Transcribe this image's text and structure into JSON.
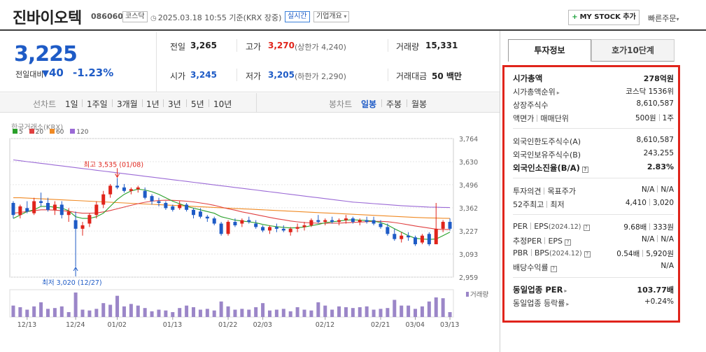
{
  "header": {
    "title": "진바이오텍",
    "code": "086060",
    "market_tag": "코스닥",
    "datetime": "2025.03.18 10:55 기준(KRX 장중)",
    "realtime_tag": "실시간",
    "company_tag": "기업개요",
    "mystock_plus": "+",
    "mystock_label": "MY STOCK 추가",
    "quick_order": "빠른주문"
  },
  "summary": {
    "price": "3,225",
    "change_label": "전일대비",
    "change_arrow": "▼",
    "change_value": "40",
    "change_pct": "-1.23%",
    "prev_close_label": "전일",
    "prev_close": "3,265",
    "high_label": "고가",
    "high": "3,270",
    "upper_limit": "(상한가 4,240)",
    "volume_label": "거래량",
    "volume": "15,331",
    "open_label": "시가",
    "open": "3,245",
    "low_label": "저가",
    "low": "3,205",
    "lower_limit": "(하한가 2,290)",
    "amount_label": "거래대금",
    "amount": "50 백만"
  },
  "period_bar": {
    "line_chart": "선차트",
    "periods": [
      "1일",
      "1주일",
      "3개월",
      "1년",
      "3년",
      "5년",
      "10년"
    ],
    "candle_chart": "봉차트",
    "candle_periods": [
      "일봉",
      "주봉",
      "월봉"
    ],
    "selected_candle": "일봉"
  },
  "chart_data": {
    "type": "candlestick",
    "source": "한국거래소(KRX)",
    "ma_legend": [
      {
        "name": "5",
        "color": "#2aa02a"
      },
      {
        "name": "20",
        "color": "#e04040"
      },
      {
        "name": "60",
        "color": "#f08a24"
      },
      {
        "name": "120",
        "color": "#9b6ad6"
      }
    ],
    "y_ticks": [
      3764,
      3630,
      3496,
      3362,
      3227,
      3093,
      2959
    ],
    "y_tick_labels": [
      "3,764",
      "3,630",
      "3,496",
      "3,362",
      "3,227",
      "3,093",
      "2,959"
    ],
    "x_labels": [
      "12/13",
      "12/24",
      "01/02",
      "01/13",
      "01/22",
      "02/03",
      "02/12",
      "02/21",
      "03/04",
      "03/13"
    ],
    "max_annotation": "최고 3,535 (01/08)",
    "min_annotation": "최저 3,020 (12/27)",
    "volume_label": "거래량",
    "candles": [
      [
        3390,
        3400,
        3300,
        3320
      ],
      [
        3320,
        3380,
        3300,
        3370
      ],
      [
        3360,
        3400,
        3330,
        3340
      ],
      [
        3330,
        3420,
        3320,
        3400
      ],
      [
        3400,
        3450,
        3370,
        3390
      ],
      [
        3390,
        3420,
        3340,
        3350
      ],
      [
        3350,
        3400,
        3320,
        3380
      ],
      [
        3380,
        3400,
        3300,
        3320
      ],
      [
        3320,
        3360,
        3280,
        3340
      ],
      [
        3290,
        3340,
        3020,
        3240
      ],
      [
        3240,
        3280,
        3200,
        3260
      ],
      [
        3270,
        3330,
        3250,
        3320
      ],
      [
        3320,
        3400,
        3300,
        3380
      ],
      [
        3380,
        3460,
        3360,
        3440
      ],
      [
        3440,
        3500,
        3420,
        3490
      ],
      [
        3490,
        3535,
        3470,
        3480
      ],
      [
        3480,
        3500,
        3450,
        3460
      ],
      [
        3460,
        3480,
        3440,
        3470
      ],
      [
        3470,
        3490,
        3450,
        3480
      ],
      [
        3460,
        3480,
        3410,
        3420
      ],
      [
        3430,
        3440,
        3380,
        3400
      ],
      [
        3400,
        3420,
        3370,
        3390
      ],
      [
        3390,
        3400,
        3350,
        3360
      ],
      [
        3370,
        3380,
        3340,
        3350
      ],
      [
        3360,
        3400,
        3350,
        3380
      ],
      [
        3380,
        3390,
        3340,
        3350
      ],
      [
        3350,
        3360,
        3300,
        3320
      ],
      [
        3340,
        3360,
        3300,
        3310
      ],
      [
        3310,
        3320,
        3280,
        3300
      ],
      [
        3300,
        3310,
        3260,
        3270
      ],
      [
        3270,
        3280,
        3200,
        3210
      ],
      [
        3210,
        3290,
        3200,
        3280
      ],
      [
        3280,
        3300,
        3250,
        3260
      ],
      [
        3270,
        3300,
        3250,
        3290
      ],
      [
        3290,
        3310,
        3270,
        3280
      ],
      [
        3270,
        3290,
        3240,
        3250
      ],
      [
        3250,
        3260,
        3220,
        3230
      ],
      [
        3230,
        3260,
        3210,
        3250
      ],
      [
        3250,
        3270,
        3220,
        3240
      ],
      [
        3240,
        3260,
        3220,
        3230
      ],
      [
        3220,
        3250,
        3200,
        3240
      ],
      [
        3240,
        3270,
        3220,
        3250
      ],
      [
        3250,
        3280,
        3230,
        3260
      ],
      [
        3260,
        3300,
        3250,
        3290
      ],
      [
        3290,
        3320,
        3270,
        3280
      ],
      [
        3280,
        3300,
        3260,
        3290
      ],
      [
        3290,
        3310,
        3270,
        3280
      ],
      [
        3280,
        3300,
        3260,
        3290
      ],
      [
        3290,
        3320,
        3270,
        3300
      ],
      [
        3300,
        3310,
        3270,
        3280
      ],
      [
        3280,
        3300,
        3260,
        3290
      ],
      [
        3290,
        3310,
        3270,
        3280
      ],
      [
        3290,
        3310,
        3260,
        3270
      ],
      [
        3270,
        3290,
        3240,
        3250
      ],
      [
        3250,
        3270,
        3200,
        3210
      ],
      [
        3210,
        3240,
        3170,
        3180
      ],
      [
        3180,
        3220,
        3160,
        3200
      ],
      [
        3200,
        3220,
        3170,
        3190
      ],
      [
        3190,
        3200,
        3140,
        3150
      ],
      [
        3160,
        3210,
        3150,
        3200
      ],
      [
        3210,
        3220,
        3140,
        3150
      ],
      [
        3150,
        3390,
        3150,
        3240
      ],
      [
        3240,
        3290,
        3220,
        3280
      ],
      [
        3280,
        3300,
        3230,
        3240
      ]
    ],
    "volumes": [
      14,
      12,
      9,
      13,
      18,
      10,
      11,
      13,
      6,
      30,
      9,
      8,
      10,
      17,
      15,
      26,
      13,
      16,
      14,
      11,
      7,
      9,
      8,
      6,
      11,
      14,
      12,
      9,
      10,
      8,
      19,
      13,
      9,
      10,
      9,
      12,
      17,
      8,
      9,
      10,
      7,
      12,
      9,
      8,
      18,
      14,
      9,
      13,
      12,
      11,
      12,
      13,
      9,
      10,
      11,
      21,
      14,
      14,
      10,
      13,
      19,
      24,
      23,
      6
    ],
    "ma5": [
      3300,
      3320,
      3340,
      3350,
      3370,
      3370,
      3365,
      3360,
      3345,
      3310,
      3300,
      3300,
      3310,
      3330,
      3370,
      3410,
      3440,
      3460,
      3470,
      3465,
      3455,
      3440,
      3420,
      3400,
      3385,
      3370,
      3360,
      3350,
      3340,
      3330,
      3310,
      3300,
      3290,
      3285,
      3280,
      3275,
      3265,
      3258,
      3252,
      3248,
      3245,
      3246,
      3250,
      3258,
      3265,
      3275,
      3280,
      3285,
      3290,
      3292,
      3290,
      3288,
      3284,
      3276,
      3262,
      3240,
      3220,
      3200,
      3185,
      3180,
      3178,
      3180,
      3200,
      3220
    ],
    "ma20": [
      3330,
      3335,
      3340,
      3345,
      3350,
      3350,
      3348,
      3345,
      3342,
      3335,
      3330,
      3330,
      3332,
      3338,
      3346,
      3356,
      3366,
      3376,
      3386,
      3394,
      3400,
      3404,
      3406,
      3405,
      3403,
      3400,
      3396,
      3390,
      3384,
      3376,
      3366,
      3356,
      3348,
      3338,
      3330,
      3322,
      3314,
      3306,
      3298,
      3292,
      3285,
      3280,
      3276,
      3274,
      3272,
      3272,
      3272,
      3273,
      3275,
      3277,
      3279,
      3281,
      3283,
      3283,
      3281,
      3276,
      3270,
      3263,
      3256,
      3250,
      3244,
      3238,
      3236,
      3236
    ],
    "ma60": [
      3420,
      3420,
      3418,
      3416,
      3414,
      3412,
      3410,
      3408,
      3406,
      3404,
      3402,
      3400,
      3398,
      3396,
      3394,
      3392,
      3390,
      3388,
      3386,
      3384,
      3382,
      3380,
      3378,
      3376,
      3374,
      3372,
      3370,
      3368,
      3366,
      3364,
      3362,
      3360,
      3358,
      3356,
      3354,
      3352,
      3350,
      3348,
      3346,
      3344,
      3342,
      3340,
      3338,
      3336,
      3334,
      3332,
      3330,
      3328,
      3326,
      3324,
      3322,
      3320,
      3318,
      3316,
      3314,
      3312,
      3310,
      3308,
      3306,
      3304,
      3303,
      3302,
      3301,
      3300
    ],
    "ma120": [
      3640,
      3635,
      3630,
      3625,
      3620,
      3615,
      3610,
      3605,
      3600,
      3595,
      3590,
      3585,
      3580,
      3575,
      3570,
      3565,
      3560,
      3555,
      3550,
      3545,
      3540,
      3535,
      3530,
      3525,
      3520,
      3515,
      3510,
      3505,
      3500,
      3495,
      3490,
      3485,
      3480,
      3475,
      3470,
      3465,
      3460,
      3455,
      3450,
      3445,
      3440,
      3435,
      3430,
      3425,
      3420,
      3415,
      3410,
      3405,
      3400,
      3395,
      3392,
      3389,
      3386,
      3383,
      3380,
      3377,
      3374,
      3372,
      3370,
      3368,
      3366,
      3365,
      3364,
      3363
    ]
  },
  "tabs": {
    "invest": "투자정보",
    "orderbook": "호가10단계"
  },
  "invest_info": {
    "market_cap_label": "시가총액",
    "market_cap": "278억원",
    "cap_rank_label": "시가총액순위",
    "cap_rank": "코스닥 1536위",
    "shares_label": "상장주식수",
    "shares": "8,610,587",
    "face_label": "액면가",
    "unit_label": "매매단위",
    "face_value": "500원",
    "trade_unit": "1주",
    "foreign_limit_label": "외국인한도주식수(A)",
    "foreign_limit": "8,610,587",
    "foreign_hold_label": "외국인보유주식수(B)",
    "foreign_hold": "243,255",
    "foreign_ratio_label": "외국인소진율(B/A)",
    "foreign_ratio": "2.83%",
    "opinion_label": "투자의견",
    "target_label": "목표주가",
    "opinion": "N/A",
    "target": "N/A",
    "w52_high_label": "52주최고",
    "w52_low_label": "최저",
    "w52_high": "4,410",
    "w52_low": "3,020",
    "per_label": "PER",
    "eps_label": "EPS",
    "year_note": "(2024.12)",
    "per": "9.68배",
    "eps": "333원",
    "est_per_label": "추정PER",
    "est_eps_label": "EPS",
    "est_per": "N/A",
    "est_eps": "N/A",
    "pbr_label": "PBR",
    "bps_label": "BPS",
    "pbr": "0.54배",
    "bps": "5,920원",
    "dividend_label": "배당수익률",
    "dividend": "N/A",
    "sector_per_label": "동일업종 PER",
    "sector_per": "103.77배",
    "sector_change_label": "동일업종 등락률",
    "sector_change": "+0.24%"
  }
}
